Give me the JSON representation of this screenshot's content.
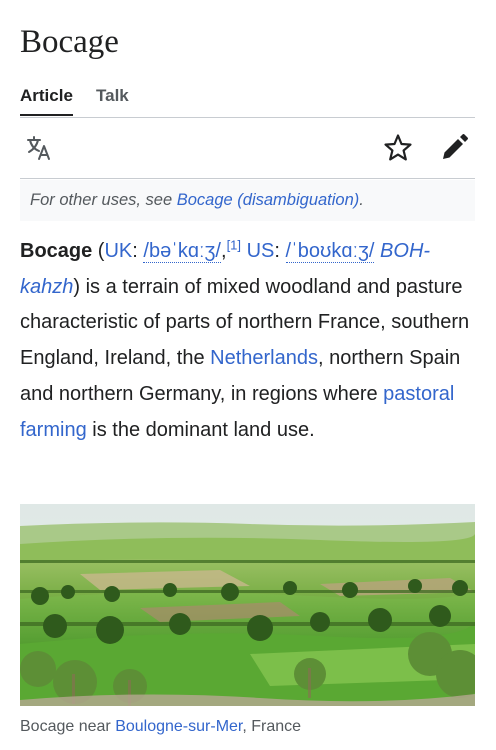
{
  "article": {
    "title": "Bocage"
  },
  "tabs": [
    {
      "label": "Article",
      "active": true
    },
    {
      "label": "Talk",
      "active": false
    }
  ],
  "actions": {
    "language_icon": "translate-icon",
    "watch_icon": "star-icon",
    "edit_icon": "pencil-icon"
  },
  "hatnote": {
    "prefix": "For other uses, see ",
    "link": "Bocage (disambiguation)",
    "suffix": "."
  },
  "intro": {
    "term": "Bocage",
    "open_paren": " (",
    "uk_label": "UK",
    "colon1": ": ",
    "uk_ipa": "/bəˈkɑːʒ/",
    "comma1": ",",
    "ref1": "[1]",
    "space1": " ",
    "us_label": "US",
    "colon2": ": ",
    "us_ipa": "/ˈboʊkɑːʒ/",
    "space2": " ",
    "respelling": "BOH-kahzh",
    "text1": ") is a terrain of mixed woodland and pasture characteristic of parts of northern France, southern England, Ireland, the ",
    "link_netherlands": "Netherlands",
    "text2": ", northern Spain and northern Germany, in regions where ",
    "link_pastoral": "pastoral farming",
    "text3": " is the dominant land use."
  },
  "figure": {
    "caption_prefix": "Bocage near ",
    "caption_link": "Boulogne-sur-Mer",
    "caption_suffix": ", France"
  },
  "colors": {
    "link": "#3366cc",
    "text": "#202122",
    "muted": "#54595d",
    "divider": "#c8ccd1",
    "hatnote_bg": "#f8f9fa"
  }
}
